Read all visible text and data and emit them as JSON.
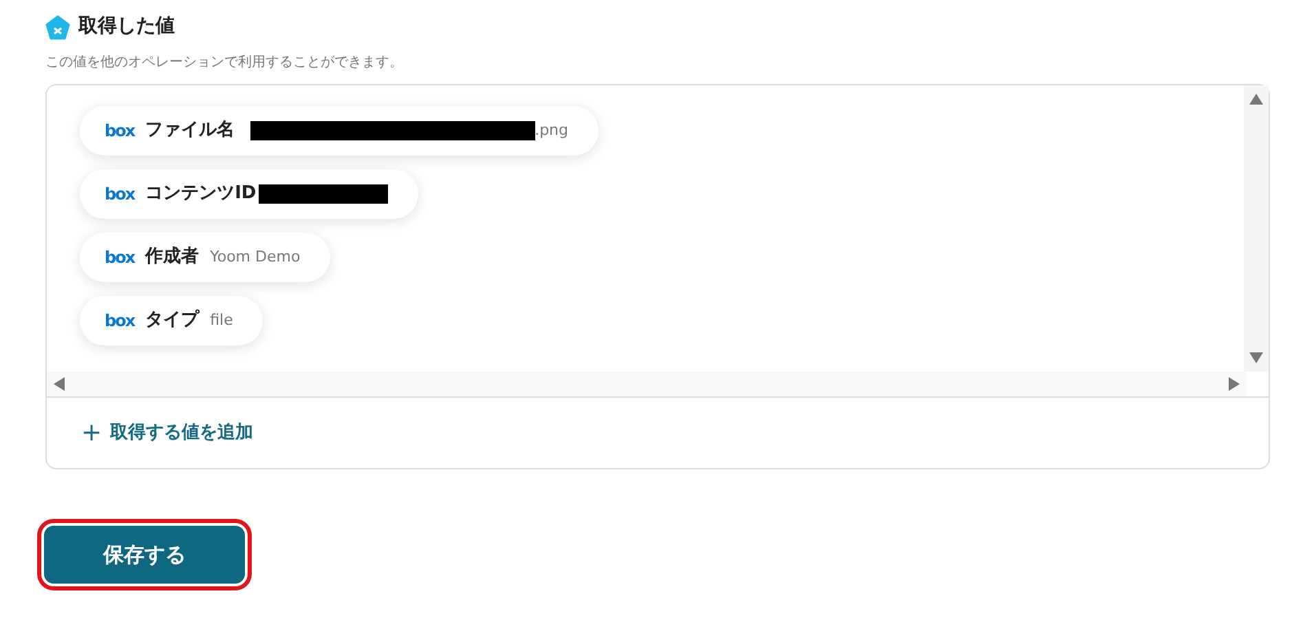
{
  "section": {
    "title": "取得した値",
    "description": "この値を他のオペレーションで利用することができます。"
  },
  "values": [
    {
      "source": "box",
      "label": "ファイル名",
      "redacted": true,
      "value": ".png"
    },
    {
      "source": "box",
      "label": "コンテンツID",
      "redacted": true
    },
    {
      "source": "box",
      "label": "作成者",
      "redacted": false,
      "value": "Yoom Demo"
    },
    {
      "source": "box",
      "label": "タイプ",
      "redacted": false,
      "value": "file"
    }
  ],
  "add_link": {
    "icon": "+",
    "label": "取得する値を追加"
  },
  "save_button": {
    "label": "保存する",
    "highlighted": true
  }
}
